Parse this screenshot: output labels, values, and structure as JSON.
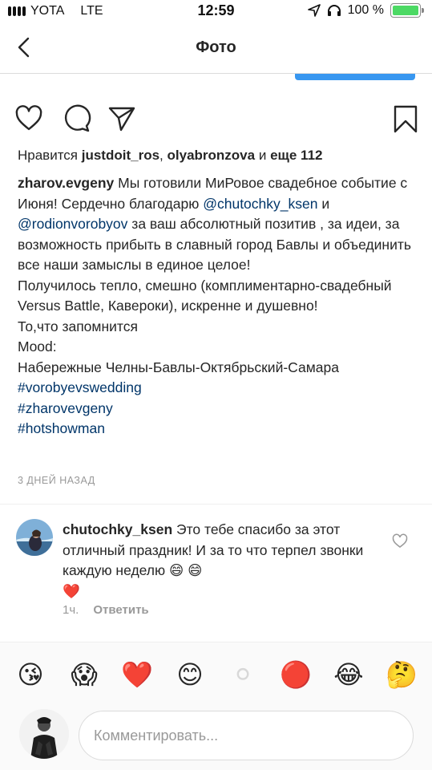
{
  "status_bar": {
    "carrier": "YOTA",
    "network": "LTE",
    "time": "12:59",
    "battery": "100 %",
    "battery_level": 1.0
  },
  "nav": {
    "title": "Фото",
    "back_icon": "chevron-left-icon"
  },
  "actions": {
    "icons": [
      "heart-icon",
      "comment-icon",
      "share-icon",
      "bookmark-icon"
    ]
  },
  "likes": {
    "prefix": "Нравится",
    "user1": "justdoit_ros",
    "sep": ",",
    "user2": "olyabronzova",
    "and": "и",
    "more": "еще 112"
  },
  "caption": {
    "user": "zharov.evgeny",
    "text1": "Мы готовили МиРовое свадебное событие с Июня! Сердечно благодарю",
    "mention1": "@chutochky_ksen",
    "and": "и",
    "mention2": "@rodionvorobyov",
    "text2": "за ваш абсолютный позитив , за идеи, за возможность прибыть в славный город Бавлы и объединить все наши замыслы в единое целое!",
    "text3": "Получилось тепло, смешно (комплиментарно-свадебный Versus Battle, Кавероки), искренне и душевно!",
    "text4": "То,что запомнится",
    "text5": "Mood:",
    "text6": "Набережные Челны-Бавлы-Октябрьский-Самара",
    "tag1": "#vorobyevswedding",
    "tag2": "#zharovevgeny",
    "tag3": "#hotshowman",
    "time_ago": "3 ДНЕЙ НАЗАД"
  },
  "comment": {
    "user": "chutochky_ksen",
    "text": "Это тебе спасибо за этот отличный праздник! И за то что терпел звонки каждую неделю",
    "emojis": "😄 😄",
    "heart_emoji": "❤️",
    "time": "1ч.",
    "reply_label": "Ответить"
  },
  "emoji_bar": [
    "😘",
    "😱",
    "❤️",
    "😊",
    "⚪",
    "🔴",
    "😂",
    "🤔"
  ],
  "compose": {
    "placeholder": "Комментировать..."
  },
  "colors": {
    "link": "#003569",
    "accent_blue": "#3897f0",
    "muted": "#999999",
    "battery_green": "#4cd964"
  }
}
